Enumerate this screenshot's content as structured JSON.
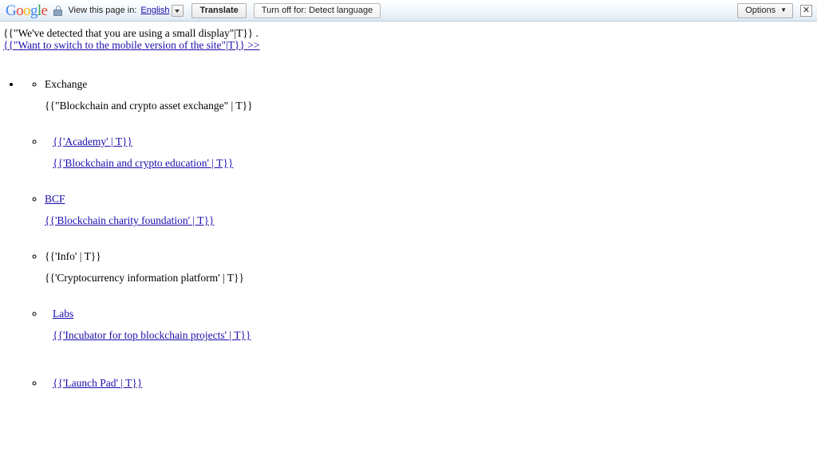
{
  "translate_bar": {
    "logo_text": "Google",
    "logo_letters": [
      {
        "char": "G",
        "color": "#4285f4"
      },
      {
        "char": "o",
        "color": "#ea4335"
      },
      {
        "char": "o",
        "color": "#fbbc05"
      },
      {
        "char": "g",
        "color": "#4285f4"
      },
      {
        "char": "l",
        "color": "#34a853"
      },
      {
        "char": "e",
        "color": "#ea4335"
      }
    ],
    "lock_icon": "lock-icon",
    "view_label": "View this page in:",
    "language_value": "English",
    "language_dropdown_icon": "chevron-down-icon",
    "translate_button": "Translate",
    "turn_off_button": "Turn off for: Detect language",
    "options_button": "Options",
    "options_caret": "▼",
    "close_button": "✕"
  },
  "notice": {
    "line1": "{{\"We've detected that you are using a small display\"|T}} .",
    "line2": "{{\"Want to switch to the mobile version of the site\"|T}} >>"
  },
  "nav": {
    "items": [
      {
        "title": "Exchange",
        "title_is_link": false,
        "desc": "{{\"Blockchain and crypto asset exchange\" | T}}",
        "desc_is_link": false,
        "extra_indent": false
      },
      {
        "title": "{{'Academy' | T}}",
        "title_is_link": true,
        "desc": "{{'Blockchain and crypto education' | T}}",
        "desc_is_link": true,
        "extra_indent": true
      },
      {
        "title": "BCF",
        "title_is_link": true,
        "desc": "{{'Blockchain charity foundation' | T}}",
        "desc_is_link": true,
        "extra_indent": false
      },
      {
        "title": "{{'Info' | T}}",
        "title_is_link": false,
        "desc": "{{'Cryptocurrency information platform' | T}}",
        "desc_is_link": false,
        "extra_indent": false
      },
      {
        "title": "Labs",
        "title_is_link": true,
        "desc": "{{'Incubator for top blockchain projects' | T}}",
        "desc_is_link": true,
        "extra_indent": true
      },
      {
        "title": "{{'Launch Pad' | T}}",
        "title_is_link": true,
        "desc": "",
        "desc_is_link": true,
        "extra_indent": true
      }
    ]
  }
}
